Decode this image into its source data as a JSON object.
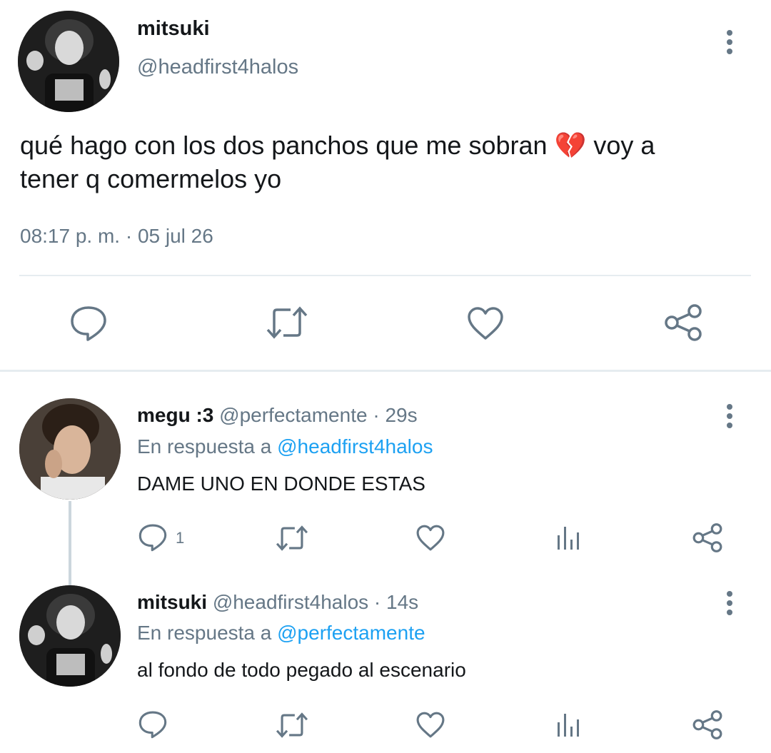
{
  "main_tweet": {
    "display_name": "mitsuki",
    "handle": "@headfirst4halos",
    "text_line1": "qué hago con los dos panchos que me sobran",
    "emoji": "💔",
    "text_line1_end": "voy a",
    "text_line2": "tener q comermelos yo",
    "timestamp": "08:17 p. m. · 05 jul 26",
    "actions": [
      "reply-icon",
      "retweet-icon",
      "like-icon",
      "share-icon"
    ]
  },
  "replies": [
    {
      "display_name": "megu :3",
      "handle": "@perfectamente",
      "separator": "·",
      "time": "29s",
      "reply_prefix": "En respuesta a",
      "reply_to": "@headfirst4halos",
      "text": "DAME UNO EN DONDE ESTAS",
      "reply_count": "1"
    },
    {
      "display_name": "mitsuki",
      "handle": "@headfirst4halos",
      "separator": "·",
      "time": "14s",
      "reply_prefix": "En respuesta a",
      "reply_to": "@perfectamente",
      "text": "al fondo de todo pegado al escenario",
      "reply_count": ""
    }
  ],
  "colors": {
    "text": "#14171a",
    "muted": "#657786",
    "link": "#1da1f2",
    "divider": "#e6ecf0"
  }
}
